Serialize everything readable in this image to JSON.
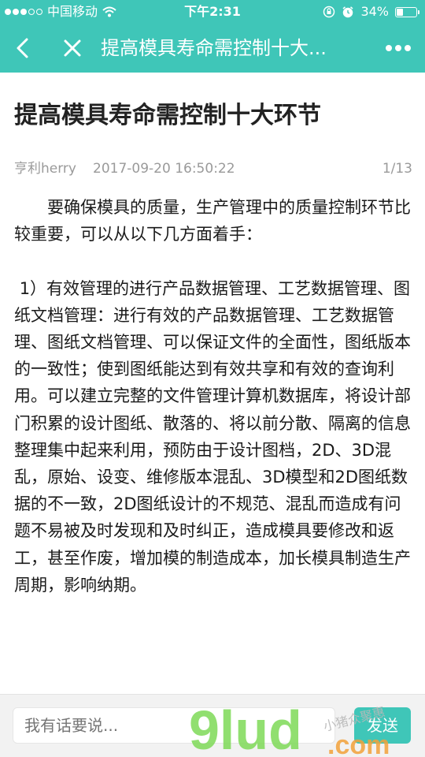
{
  "status_bar": {
    "carrier": "中国移动",
    "time": "下午2:31",
    "battery": "34%",
    "battery_level": 0.34,
    "signal_dots_filled": 3,
    "signal_dots_total": 5
  },
  "nav": {
    "title": "提高模具寿命需控制十大..."
  },
  "article": {
    "title": "提高模具寿命需控制十大环节",
    "author": "亨利herry",
    "date": "2017-09-20 16:50:22",
    "page": "1/13",
    "paragraphs": [
      "要确保模具的质量，生产管理中的质量控制环节比较重要，可以从以下几方面着手：",
      " 1）有效管理的进行产品数据管理、工艺数据管理、图纸文档管理：进行有效的产品数据管理、工艺数据管理、图纸文档管理、可以保证文件的全面性，图纸版本的一致性；使到图纸能达到有效共享和有效的查询利用。可以建立完整的文件管理计算机数据库，将设计部门积累的设计图纸、散落的、将以前分散、隔离的信息整理集中起来利用，预防由于设计图档，2D、3D混乱，原始、设变、维修版本混乱、3D模型和2D图纸数据的不一致，2D图纸设计的不规范、混乱而造成有问题不易被及时发现和及时纠正，造成模具要修改和返工，甚至作废，增加模的制造成本，加长模具制造生产周期，影响纳期。"
    ]
  },
  "bottom": {
    "comment_placeholder": "我有话要说...",
    "send_label": "发送"
  },
  "watermark": {
    "main": "9lud",
    "suffix": ".com",
    "script": "小猪众聚惠"
  },
  "colors": {
    "accent": "#3fc6b8",
    "watermark_green": "#7ed957"
  }
}
